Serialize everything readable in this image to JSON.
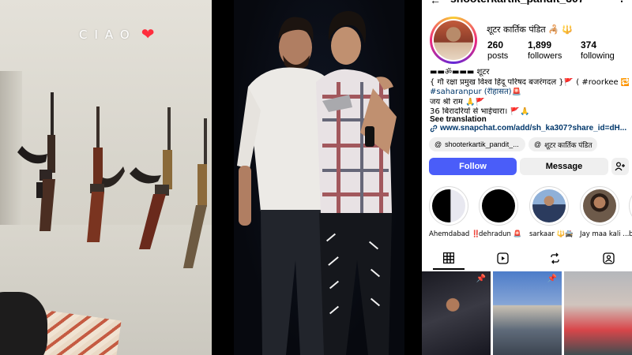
{
  "story": {
    "caption": "CIAO",
    "heart": "❤"
  },
  "profile": {
    "username": "shooterkartik_pandit_307",
    "display_name": "शूटर कार्तिक पंडित 🦂 🔱",
    "stats": [
      {
        "value": "260",
        "label": "posts"
      },
      {
        "value": "1,899",
        "label": "followers"
      },
      {
        "value": "374",
        "label": "following"
      }
    ],
    "bio_lines": [
      "▬▬ॐ▬▬▬ शूटर",
      "{ गौ रक्षा प्रमुख विश्व हिंदू परिषद बजरंगदल }🚩 ( #roorkee 🔁",
      "#saharanpur (रीहासत)🚨",
      "जय श्री राम 🙏🚩",
      "36 बिरादरियों से भाईचारा। 🚩🙏"
    ],
    "bio_link_texts": [
      "#roorkee",
      "#saharanpur"
    ],
    "see_translation": "See translation",
    "link": "www.snapchat.com/add/sh_ka307?share_id=dH...",
    "chips": [
      "shooterkartik_pandit_...",
      "शूटर कार्तिक पंडित"
    ],
    "buttons": {
      "follow": "Follow",
      "message": "Message"
    },
    "highlights": [
      "Ahemdabad ‼️",
      "dehradun 🚨",
      "sarkaar 🔱🚔",
      "Jay maa kali ...",
      "bi"
    ],
    "colors": {
      "follow_button": "#4a5df9",
      "link": "#00376b",
      "story_ring": [
        "#f9ce34",
        "#ee2a7b",
        "#6228d7"
      ]
    }
  },
  "icons": [
    "back-arrow-icon",
    "more-icon",
    "add-user-icon",
    "link-icon",
    "threads-icon",
    "grid-tab-icon",
    "reels-tab-icon",
    "reposts-tab-icon",
    "tagged-tab-icon",
    "pin-icon"
  ]
}
